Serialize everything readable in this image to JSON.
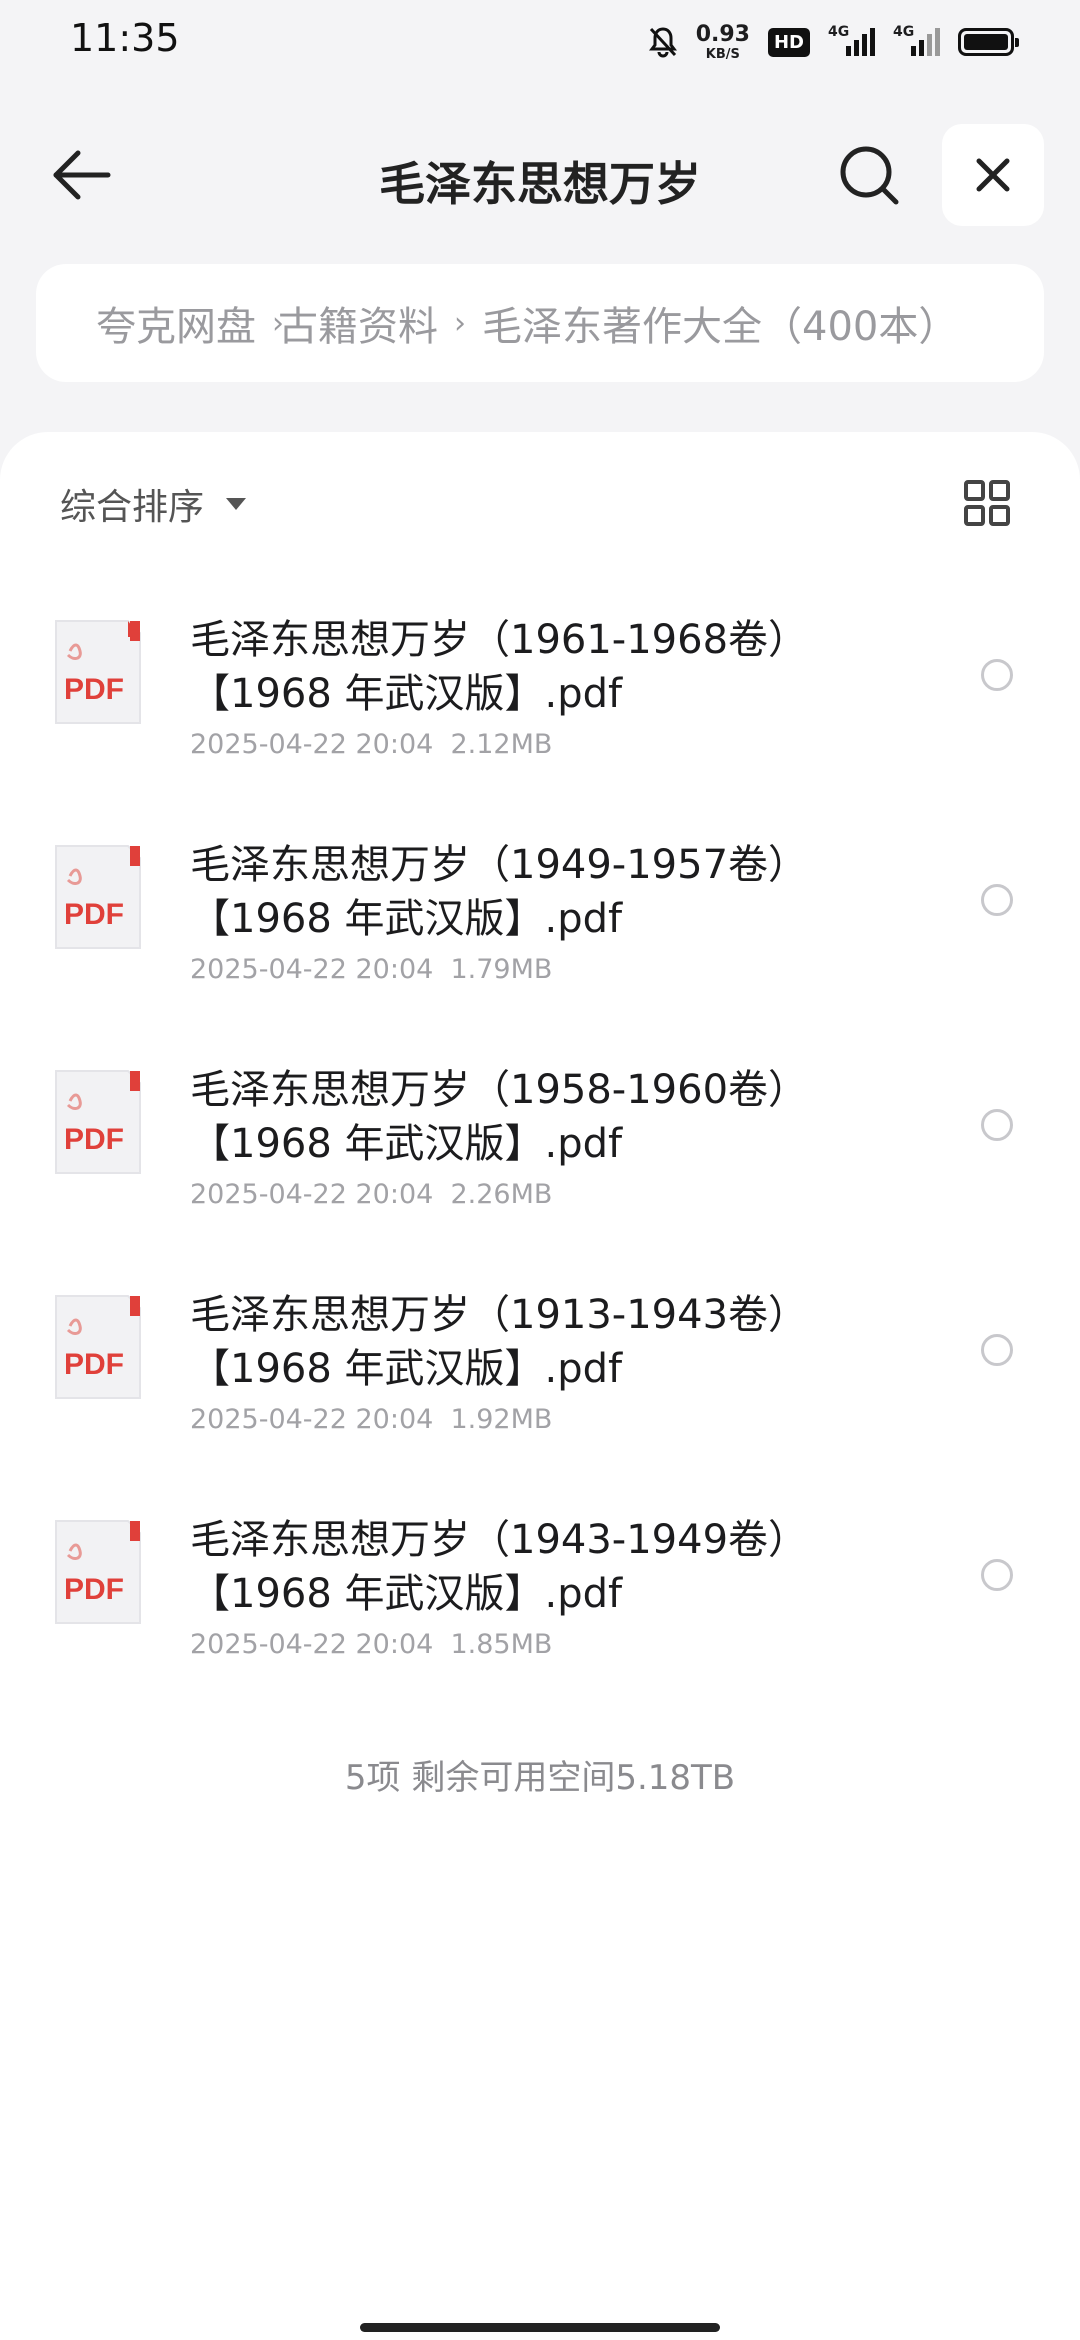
{
  "status_bar": {
    "time": "11:35",
    "net_speed": "0.93",
    "net_unit": "KB/S",
    "hd_label": "HD",
    "sim1_label": "4G",
    "sim2_label": "4G",
    "icons": [
      "mute-bell-icon",
      "signal-icon",
      "battery-icon"
    ]
  },
  "header": {
    "title": "毛泽东思想万岁",
    "back_icon": "arrow-left-icon",
    "search_icon": "search-icon",
    "close_icon": "close-icon"
  },
  "breadcrumb": {
    "items": [
      "夸克网盘",
      "古籍资料",
      "毛泽东著作大全（400本）"
    ]
  },
  "toolbar": {
    "sort_label": "综合排序",
    "view_icon": "grid-view-icon"
  },
  "files": [
    {
      "name": "毛泽东思想万岁（1961-1968卷）【1968 年武汉版】.pdf",
      "date": "2025-04-22 20:04",
      "size": "2.12MB",
      "type": "PDF"
    },
    {
      "name": "毛泽东思想万岁（1949-1957卷）【1968 年武汉版】.pdf",
      "date": "2025-04-22 20:04",
      "size": "1.79MB",
      "type": "PDF"
    },
    {
      "name": "毛泽东思想万岁（1958-1960卷）【1968 年武汉版】.pdf",
      "date": "2025-04-22 20:04",
      "size": "2.26MB",
      "type": "PDF"
    },
    {
      "name": "毛泽东思想万岁（1913-1943卷）【1968 年武汉版】.pdf",
      "date": "2025-04-22 20:04",
      "size": "1.92MB",
      "type": "PDF"
    },
    {
      "name": "毛泽东思想万岁（1943-1949卷）【1968 年武汉版】.pdf",
      "date": "2025-04-22 20:04",
      "size": "1.85MB",
      "type": "PDF"
    }
  ],
  "footer": {
    "summary": "5项 剩余可用空间5.18TB"
  },
  "colors": {
    "pdf_red": "#e0403a",
    "background": "#f4f4f6",
    "card": "#ffffff",
    "muted_text": "#a2a2a6"
  }
}
